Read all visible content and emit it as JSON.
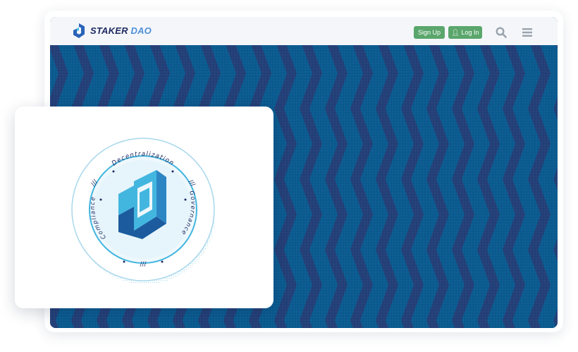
{
  "header": {
    "logo_word_1": "STAKER",
    "logo_word_2": "DAO",
    "signup_label": "Sign Up",
    "login_label": "Log In",
    "icons": [
      "user-icon",
      "search-icon",
      "hamburger-menu-icon"
    ]
  },
  "badge": {
    "top_text": "Decentralization",
    "right_text": "Governance",
    "left_text": "Compliance",
    "mark": "///"
  },
  "colors": {
    "banner_dark": "#233f77",
    "banner_light": "#0a5a8f",
    "button_green": "#5aa66c",
    "logo_navy": "#1f2a63",
    "logo_blue": "#4d8fd8",
    "badge_cyan": "#43b6e0",
    "badge_navy": "#1b5b9e",
    "badge_ring": "#a8d8ec"
  }
}
